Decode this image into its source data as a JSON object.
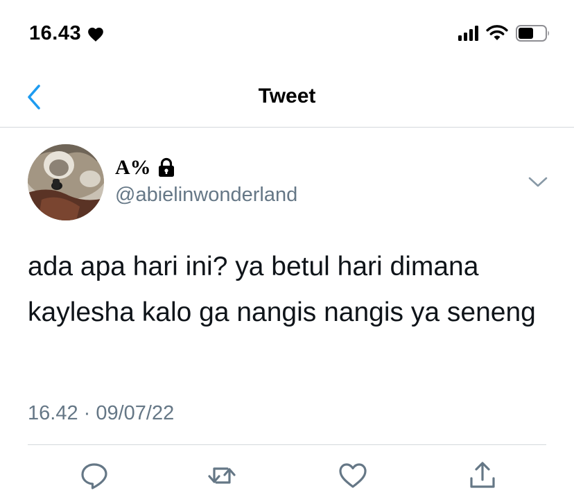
{
  "status_bar": {
    "time": "16.43",
    "icons": [
      "heart-icon",
      "cellular-signal-icon",
      "wifi-icon",
      "battery-icon"
    ]
  },
  "nav": {
    "title": "Tweet",
    "back_icon": "chevron-left-icon"
  },
  "tweet": {
    "display_name": "A%",
    "handle": "@abielinwonderland",
    "protected_icon": "lock-icon",
    "text": "ada apa hari ini? ya betul hari dimana kaylesha kalo ga nangis nangis ya seneng",
    "timestamp": "16.42 · 09/07/22"
  },
  "actions": [
    "reply-icon",
    "retweet-icon",
    "like-icon",
    "share-icon"
  ],
  "colors": {
    "accent": "#1d9bf0",
    "secondary_text": "#657786",
    "divider": "#d4d8dc"
  }
}
